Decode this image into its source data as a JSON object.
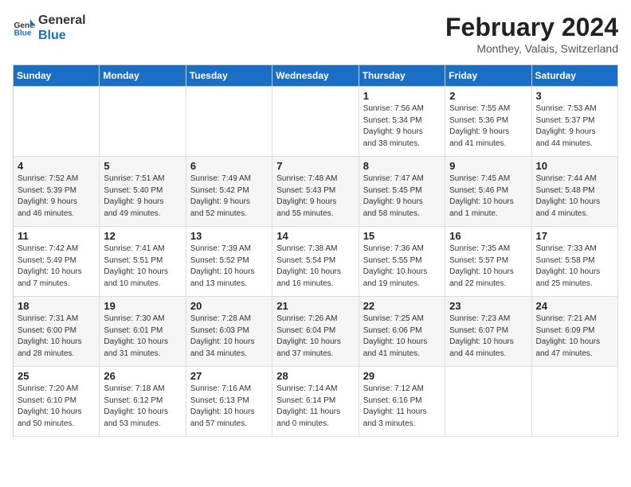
{
  "header": {
    "logo_general": "General",
    "logo_blue": "Blue",
    "month_title": "February 2024",
    "subtitle": "Monthey, Valais, Switzerland"
  },
  "days_of_week": [
    "Sunday",
    "Monday",
    "Tuesday",
    "Wednesday",
    "Thursday",
    "Friday",
    "Saturday"
  ],
  "weeks": [
    [
      {
        "day": "",
        "info": ""
      },
      {
        "day": "",
        "info": ""
      },
      {
        "day": "",
        "info": ""
      },
      {
        "day": "",
        "info": ""
      },
      {
        "day": "1",
        "info": "Sunrise: 7:56 AM\nSunset: 5:34 PM\nDaylight: 9 hours\nand 38 minutes."
      },
      {
        "day": "2",
        "info": "Sunrise: 7:55 AM\nSunset: 5:36 PM\nDaylight: 9 hours\nand 41 minutes."
      },
      {
        "day": "3",
        "info": "Sunrise: 7:53 AM\nSunset: 5:37 PM\nDaylight: 9 hours\nand 44 minutes."
      }
    ],
    [
      {
        "day": "4",
        "info": "Sunrise: 7:52 AM\nSunset: 5:39 PM\nDaylight: 9 hours\nand 46 minutes."
      },
      {
        "day": "5",
        "info": "Sunrise: 7:51 AM\nSunset: 5:40 PM\nDaylight: 9 hours\nand 49 minutes."
      },
      {
        "day": "6",
        "info": "Sunrise: 7:49 AM\nSunset: 5:42 PM\nDaylight: 9 hours\nand 52 minutes."
      },
      {
        "day": "7",
        "info": "Sunrise: 7:48 AM\nSunset: 5:43 PM\nDaylight: 9 hours\nand 55 minutes."
      },
      {
        "day": "8",
        "info": "Sunrise: 7:47 AM\nSunset: 5:45 PM\nDaylight: 9 hours\nand 58 minutes."
      },
      {
        "day": "9",
        "info": "Sunrise: 7:45 AM\nSunset: 5:46 PM\nDaylight: 10 hours\nand 1 minute."
      },
      {
        "day": "10",
        "info": "Sunrise: 7:44 AM\nSunset: 5:48 PM\nDaylight: 10 hours\nand 4 minutes."
      }
    ],
    [
      {
        "day": "11",
        "info": "Sunrise: 7:42 AM\nSunset: 5:49 PM\nDaylight: 10 hours\nand 7 minutes."
      },
      {
        "day": "12",
        "info": "Sunrise: 7:41 AM\nSunset: 5:51 PM\nDaylight: 10 hours\nand 10 minutes."
      },
      {
        "day": "13",
        "info": "Sunrise: 7:39 AM\nSunset: 5:52 PM\nDaylight: 10 hours\nand 13 minutes."
      },
      {
        "day": "14",
        "info": "Sunrise: 7:38 AM\nSunset: 5:54 PM\nDaylight: 10 hours\nand 16 minutes."
      },
      {
        "day": "15",
        "info": "Sunrise: 7:36 AM\nSunset: 5:55 PM\nDaylight: 10 hours\nand 19 minutes."
      },
      {
        "day": "16",
        "info": "Sunrise: 7:35 AM\nSunset: 5:57 PM\nDaylight: 10 hours\nand 22 minutes."
      },
      {
        "day": "17",
        "info": "Sunrise: 7:33 AM\nSunset: 5:58 PM\nDaylight: 10 hours\nand 25 minutes."
      }
    ],
    [
      {
        "day": "18",
        "info": "Sunrise: 7:31 AM\nSunset: 6:00 PM\nDaylight: 10 hours\nand 28 minutes."
      },
      {
        "day": "19",
        "info": "Sunrise: 7:30 AM\nSunset: 6:01 PM\nDaylight: 10 hours\nand 31 minutes."
      },
      {
        "day": "20",
        "info": "Sunrise: 7:28 AM\nSunset: 6:03 PM\nDaylight: 10 hours\nand 34 minutes."
      },
      {
        "day": "21",
        "info": "Sunrise: 7:26 AM\nSunset: 6:04 PM\nDaylight: 10 hours\nand 37 minutes."
      },
      {
        "day": "22",
        "info": "Sunrise: 7:25 AM\nSunset: 6:06 PM\nDaylight: 10 hours\nand 41 minutes."
      },
      {
        "day": "23",
        "info": "Sunrise: 7:23 AM\nSunset: 6:07 PM\nDaylight: 10 hours\nand 44 minutes."
      },
      {
        "day": "24",
        "info": "Sunrise: 7:21 AM\nSunset: 6:09 PM\nDaylight: 10 hours\nand 47 minutes."
      }
    ],
    [
      {
        "day": "25",
        "info": "Sunrise: 7:20 AM\nSunset: 6:10 PM\nDaylight: 10 hours\nand 50 minutes."
      },
      {
        "day": "26",
        "info": "Sunrise: 7:18 AM\nSunset: 6:12 PM\nDaylight: 10 hours\nand 53 minutes."
      },
      {
        "day": "27",
        "info": "Sunrise: 7:16 AM\nSunset: 6:13 PM\nDaylight: 10 hours\nand 57 minutes."
      },
      {
        "day": "28",
        "info": "Sunrise: 7:14 AM\nSunset: 6:14 PM\nDaylight: 11 hours\nand 0 minutes."
      },
      {
        "day": "29",
        "info": "Sunrise: 7:12 AM\nSunset: 6:16 PM\nDaylight: 11 hours\nand 3 minutes."
      },
      {
        "day": "",
        "info": ""
      },
      {
        "day": "",
        "info": ""
      }
    ]
  ]
}
